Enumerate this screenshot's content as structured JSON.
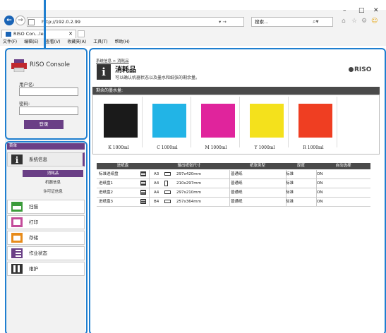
{
  "browser": {
    "url": "http://192.0.2.99",
    "search_placeholder": "搜索...",
    "tab_title": "RISO Con…le",
    "menu": [
      "文件(F)",
      "编辑(E)",
      "查看(V)",
      "收藏夹(A)",
      "工具(T)",
      "帮助(H)"
    ]
  },
  "sidebar": {
    "logo": "RISO Console",
    "username_label": "用户名:",
    "password_label": "密码:",
    "login_label": "登录",
    "menu_header": "菜单",
    "items": [
      {
        "label": "系统信息",
        "icon": "info-icon"
      },
      {
        "label": "扫描",
        "icon": "scan-icon"
      },
      {
        "label": "打印",
        "icon": "print-icon"
      },
      {
        "label": "存储",
        "icon": "storage-icon"
      },
      {
        "label": "作业状态",
        "icon": "job-status-icon"
      },
      {
        "label": "维护",
        "icon": "maintenance-icon"
      }
    ],
    "subitems": [
      "消耗品",
      "机器信息",
      "许可证信息"
    ]
  },
  "page": {
    "breadcrumb": "系统信息 > 消耗品",
    "title": "消耗品",
    "description": "可以确认机器状态以及墨水和纸张的剩余量。",
    "brand": "RISO",
    "ink_header": "剩余的墨水量:",
    "inks": [
      {
        "label": "K 1000ml",
        "color": "#1a1a1a"
      },
      {
        "label": "C 1000ml",
        "color": "#22b4e6"
      },
      {
        "label": "M 1000ml",
        "color": "#e0249c"
      },
      {
        "label": "Y 1000ml",
        "color": "#f4e11c"
      },
      {
        "label": "R 1000ml",
        "color": "#ef3e22"
      }
    ],
    "tray_headers": [
      "进纸盘",
      "输出纸张尺寸",
      "纸张类型",
      "厚度",
      "自动选择"
    ],
    "trays": [
      {
        "name": "标准进纸盘",
        "size": "A3",
        "dims": "297x420mm",
        "type": "普通纸",
        "thick": "标准",
        "auto": "ON"
      },
      {
        "name": "进纸盘1",
        "size": "A4",
        "dims": "210x297mm",
        "type": "普通纸",
        "thick": "标准",
        "auto": "ON"
      },
      {
        "name": "进纸盘2",
        "size": "A4",
        "dims": "297x210mm",
        "type": "普通纸",
        "thick": "标准",
        "auto": "ON"
      },
      {
        "name": "进纸盘3",
        "size": "B4",
        "dims": "257x364mm",
        "type": "普通纸",
        "thick": "标准",
        "auto": "ON"
      }
    ]
  }
}
